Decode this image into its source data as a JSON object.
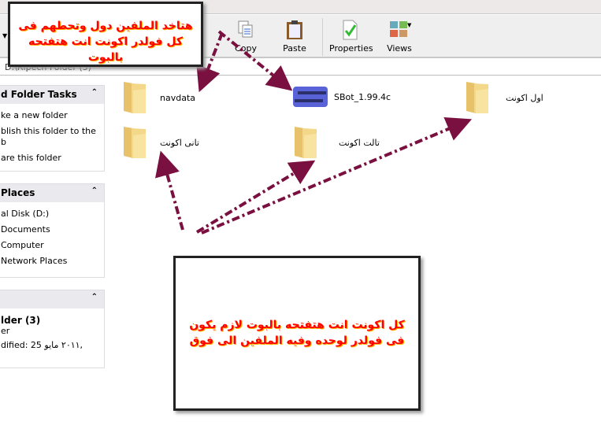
{
  "toolbar": {
    "copy": "Copy",
    "paste": "Paste",
    "properties": "Properties",
    "views": "Views"
  },
  "address": {
    "path": "D:\\Ripech Folder (3)"
  },
  "tasks": {
    "title": "d Folder Tasks",
    "items": [
      "ke a new folder",
      "blish this folder to the",
      "b",
      "are this folder"
    ]
  },
  "places": {
    "title": "Places",
    "items": [
      "al Disk (D:)",
      "Documents",
      "Computer",
      "Network Places"
    ]
  },
  "details": {
    "title": "lder (3)",
    "type": "er",
    "modified": "dified: 25 ٢٠١١ مايو,"
  },
  "files": [
    {
      "name": "navdata",
      "kind": "folder"
    },
    {
      "name": "SBot_1.99.4c",
      "kind": "app"
    },
    {
      "name": "اول اكونت",
      "kind": "folder"
    },
    {
      "name": "تانى اكونت",
      "kind": "folder"
    },
    {
      "name": "تالت اكونت",
      "kind": "folder"
    }
  ],
  "callouts": {
    "top": "هتاخد الملفين دول وتحطهم فى كل فولدر اكونت انت هتفتحه بالبوت",
    "bottom": "كل اكونت انت هتفتحه بالبوت لازم يكون فى فولدر لوحده وفيه الملفين الى فوق"
  },
  "colors": {
    "arrow": "#7a1040",
    "callout_text": "#ff0000",
    "folder": "#f3d88a"
  }
}
